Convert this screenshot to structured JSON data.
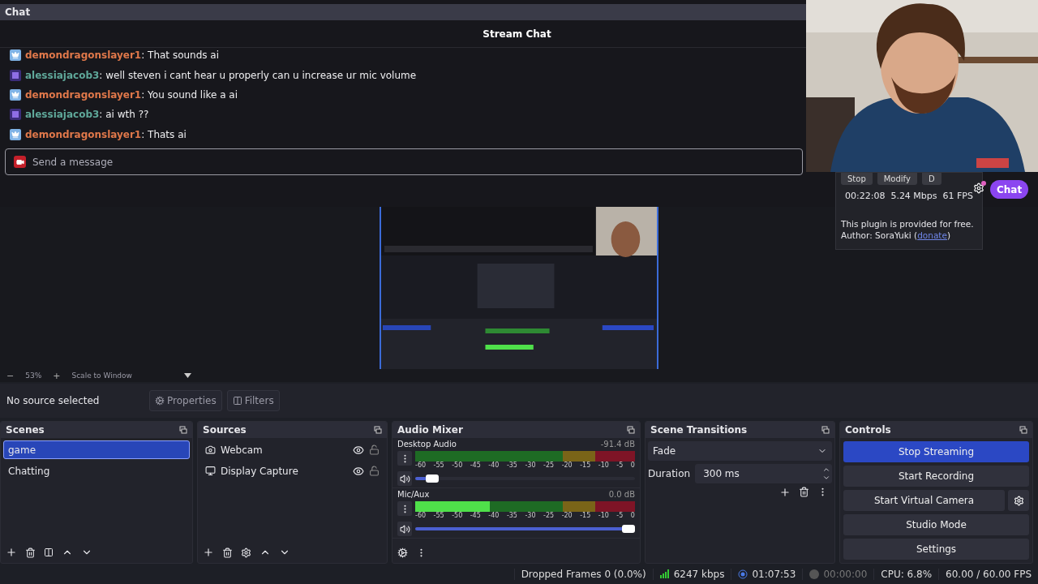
{
  "chat_dock": {
    "title": "Chat",
    "header": "Stream Chat",
    "input_placeholder": "Send a message",
    "messages": [
      {
        "kind": "crown",
        "user": "demondragonslayer1",
        "color": "#e0784a",
        "text": ": That sounds ai"
      },
      {
        "kind": "year",
        "user": "alessiajacob3",
        "color": "#5fa89a",
        "text": ": well steven i cant hear u properly can u increase ur mic volume"
      },
      {
        "kind": "crown",
        "user": "demondragonslayer1",
        "color": "#e0784a",
        "text": ": You sound like a ai"
      },
      {
        "kind": "year",
        "user": "alessiajacob3",
        "color": "#5fa89a",
        "text": ": ai wth ??"
      },
      {
        "kind": "crown",
        "user": "demondragonslayer1",
        "color": "#e0784a",
        "text": ": Thats ai"
      }
    ]
  },
  "plugin_panel": {
    "buttons": [
      "Stop",
      "Modify",
      "D"
    ],
    "stats": "00:22:08  5.24 Mbps  61 FPS",
    "note": "This plugin is provided for free.",
    "author": "Author: SoraYuki (",
    "link": "donate",
    "author_end": ")"
  },
  "chat_button": "Chat",
  "preview_bar": {
    "minus": "−",
    "zoom": "53%",
    "plus": "+",
    "scale": "Scale to Window"
  },
  "source_bar": {
    "status": "No source selected",
    "buttons": [
      {
        "kind": "gear",
        "label": "Properties"
      },
      {
        "kind": "filter",
        "label": "Filters"
      }
    ]
  },
  "scenes": {
    "title": "Scenes",
    "items": [
      {
        "label": "game",
        "selected": true
      },
      {
        "label": "Chatting",
        "selected": false
      }
    ]
  },
  "sources": {
    "title": "Sources",
    "items": [
      {
        "kind": "camera",
        "label": "Webcam",
        "visible": true,
        "locked": false
      },
      {
        "kind": "monitor",
        "label": "Display Capture",
        "visible": true,
        "locked": false
      }
    ]
  },
  "audio_mixer": {
    "title": "Audio Mixer",
    "channels": [
      {
        "name": "Desktop Audio",
        "reading": "-91.4 dB",
        "level": 0.05,
        "scale": [
          "-60",
          "-55",
          "-50",
          "-45",
          "-40",
          "-35",
          "-30",
          "-25",
          "-20",
          "-15",
          "-10",
          "-5",
          "0"
        ]
      },
      {
        "name": "Mic/Aux",
        "reading": "0.0 dB",
        "meter": {
          "level": 0.34
        },
        "level": 1,
        "scale": [
          "-60",
          "-55",
          "-50",
          "-45",
          "-40",
          "-35",
          "-30",
          "-25",
          "-20",
          "-15",
          "-10",
          "-5",
          "0"
        ]
      }
    ]
  },
  "scene_transitions": {
    "title": "Scene Transitions",
    "transition": "Fade",
    "duration_label": "Duration",
    "duration": "300 ms"
  },
  "controls": {
    "title": "Controls",
    "buttons": [
      {
        "label": "Stop Streaming",
        "active": true,
        "gear": false
      },
      {
        "label": "Start Recording",
        "active": false,
        "gear": false
      },
      {
        "label": "Start Virtual Camera",
        "active": false,
        "gear": true
      },
      {
        "label": "Studio Mode",
        "active": false,
        "gear": false
      },
      {
        "label": "Settings",
        "active": false,
        "gear": false
      }
    ]
  },
  "status_bar": {
    "dropped": "Dropped Frames 0 (0.0%)",
    "bitrate": "6247 kbps",
    "stream_time": "01:07:53",
    "record_time": "00:00:00",
    "cpu": "CPU: 6.8%",
    "fps": "60.00 / 60.00 FPS"
  }
}
